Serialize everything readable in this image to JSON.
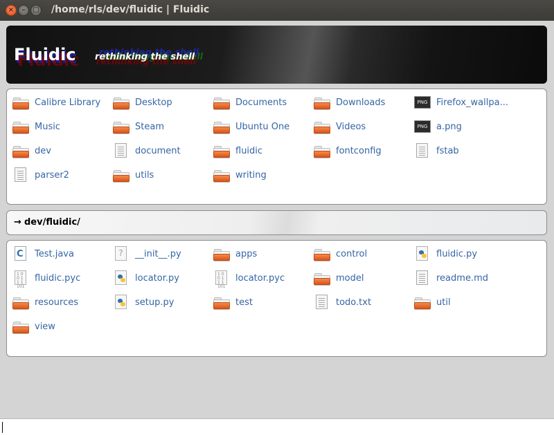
{
  "window": {
    "title": "/home/rls/dev/fluidic | Fluidic",
    "close_glyph": "×",
    "minimize_glyph": "–",
    "maximize_glyph": "□"
  },
  "banner": {
    "title": "Fluidic",
    "subtitle": "rethinking the shell"
  },
  "home_items": [
    {
      "label": "Calibre Library",
      "icon": "folder"
    },
    {
      "label": "Desktop",
      "icon": "folder"
    },
    {
      "label": "Documents",
      "icon": "folder"
    },
    {
      "label": "Downloads",
      "icon": "folder"
    },
    {
      "label": "Firefox_wallpa...",
      "icon": "png"
    },
    {
      "label": "Music",
      "icon": "folder"
    },
    {
      "label": "Steam",
      "icon": "folder"
    },
    {
      "label": "Ubuntu One",
      "icon": "folder"
    },
    {
      "label": "Videos",
      "icon": "folder"
    },
    {
      "label": "a.png",
      "icon": "png"
    },
    {
      "label": "dev",
      "icon": "folder"
    },
    {
      "label": "document",
      "icon": "text"
    },
    {
      "label": "fluidic",
      "icon": "folder"
    },
    {
      "label": "fontconfig",
      "icon": "folder"
    },
    {
      "label": "fstab",
      "icon": "text"
    },
    {
      "label": "parser2",
      "icon": "text"
    },
    {
      "label": "utils",
      "icon": "folder"
    },
    {
      "label": "writing",
      "icon": "folder"
    }
  ],
  "path": {
    "arrow": "→",
    "text": "dev/fluidic/"
  },
  "dir_items": [
    {
      "label": "Test.java",
      "icon": "java"
    },
    {
      "label": "__init__.py",
      "icon": "unknown"
    },
    {
      "label": "apps",
      "icon": "folder"
    },
    {
      "label": "control",
      "icon": "folder"
    },
    {
      "label": "fluidic.py",
      "icon": "python"
    },
    {
      "label": "fluidic.pyc",
      "icon": "binary"
    },
    {
      "label": "locator.py",
      "icon": "python"
    },
    {
      "label": "locator.pyc",
      "icon": "binary"
    },
    {
      "label": "model",
      "icon": "folder"
    },
    {
      "label": "readme.md",
      "icon": "text"
    },
    {
      "label": "resources",
      "icon": "folder"
    },
    {
      "label": "setup.py",
      "icon": "python"
    },
    {
      "label": "test",
      "icon": "folder"
    },
    {
      "label": "todo.txt",
      "icon": "text"
    },
    {
      "label": "util",
      "icon": "folder"
    },
    {
      "label": "view",
      "icon": "folder"
    }
  ],
  "command": {
    "value": ""
  }
}
